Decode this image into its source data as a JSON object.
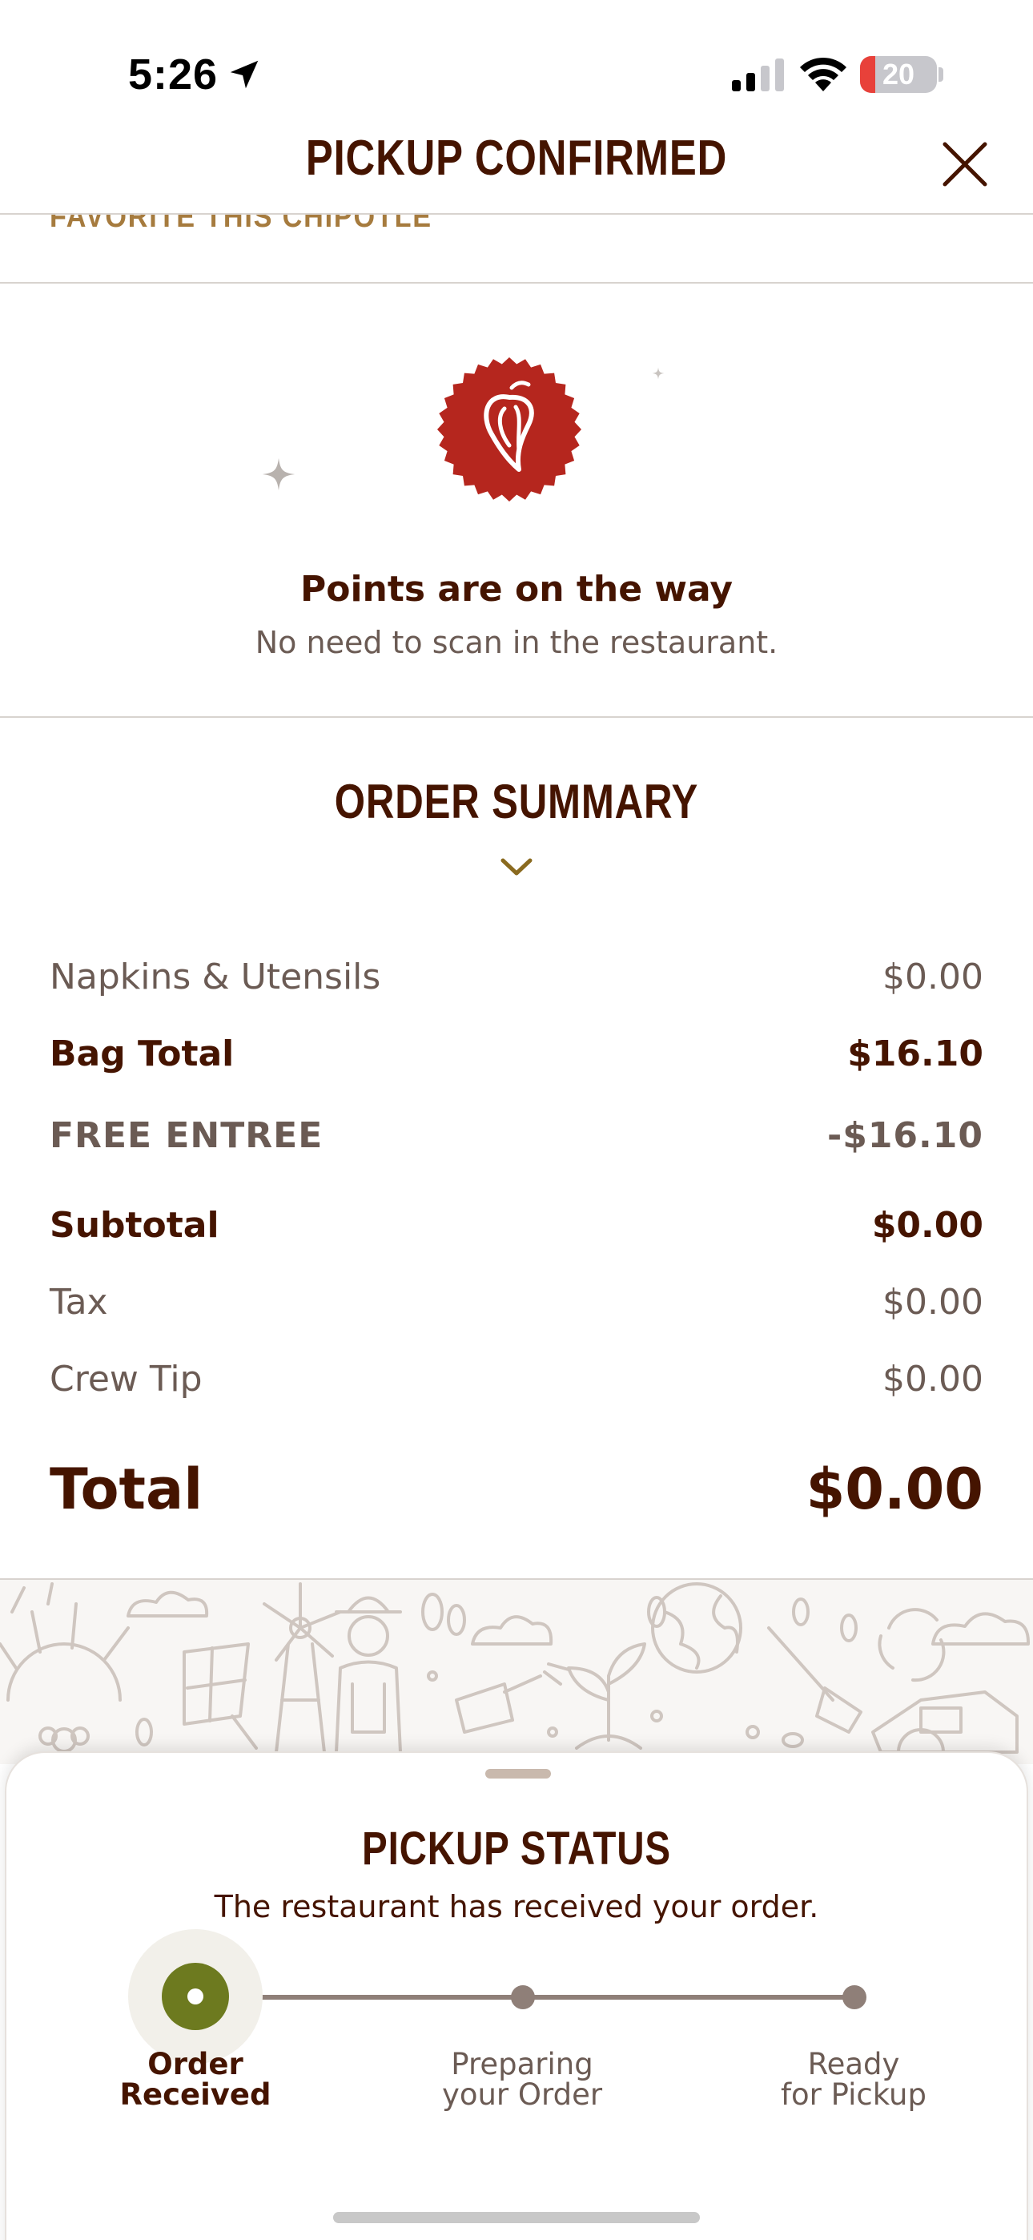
{
  "status_bar": {
    "time": "5:26",
    "battery_level": "20",
    "battery_color": "#e8413a",
    "icons": [
      "location-arrow-icon",
      "cellular-signal-icon",
      "wifi-icon",
      "battery-icon"
    ]
  },
  "header": {
    "title": "PICKUP CONFIRMED",
    "close_icon": "close-icon"
  },
  "scrolled_link": "FAVORITE THIS CHIPOTLE",
  "points": {
    "badge_icon": "chipotle-pepper-icon",
    "title": "Points are on the way",
    "subtitle": "No need to scan in the restaurant."
  },
  "order_summary": {
    "title": "ORDER SUMMARY",
    "toggle_icon": "chevron-down-icon",
    "lines": [
      {
        "label": "Napkins & Utensils",
        "value": "$0.00"
      },
      {
        "label": "Bag Total",
        "value": "$16.10"
      },
      {
        "label": "FREE ENTREE",
        "value": "-$16.10"
      },
      {
        "label": "Subtotal",
        "value": "$0.00"
      },
      {
        "label": "Tax",
        "value": "$0.00"
      },
      {
        "label": "Crew Tip",
        "value": "$0.00"
      }
    ],
    "total": {
      "label": "Total",
      "value": "$0.00"
    }
  },
  "pickup_status": {
    "title": "PICKUP STATUS",
    "message": "The restaurant has received your order.",
    "current_step": 1,
    "steps": [
      {
        "line1": "Order",
        "line2": "Received"
      },
      {
        "line1": "Preparing",
        "line2": "your Order"
      },
      {
        "line1": "Ready",
        "line2": "for Pickup"
      }
    ]
  },
  "colors": {
    "brand_brown": "#451400",
    "accent_gold": "#a67b3e",
    "chipotle_red": "#b5261e",
    "status_green": "#6d7a1f"
  }
}
